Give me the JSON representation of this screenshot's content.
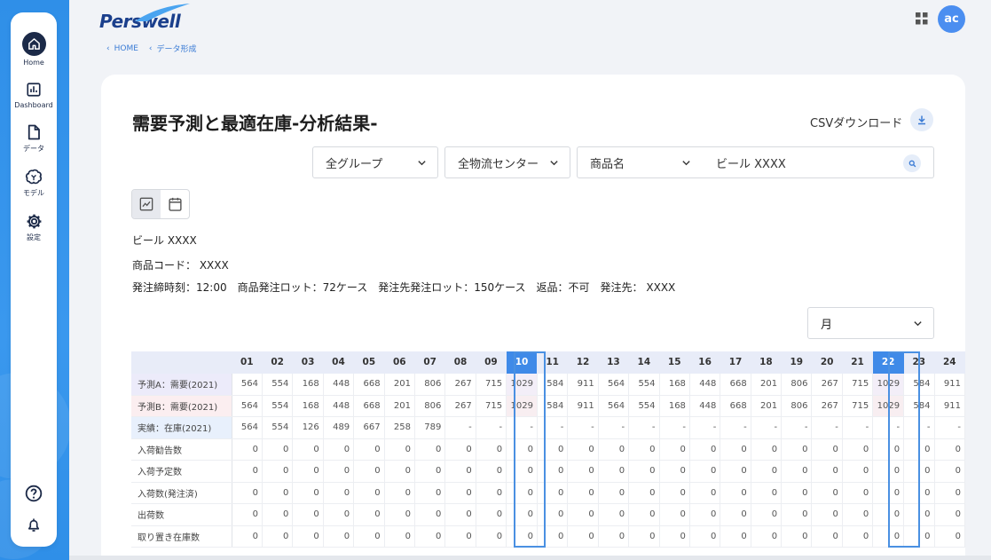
{
  "header": {
    "logo_text": "Perswell",
    "breadcrumb": [
      "HOME",
      "データ形成"
    ],
    "avatar_initials": "ac"
  },
  "sidebar": {
    "items": [
      {
        "label": "Home",
        "icon": "home-icon"
      },
      {
        "label": "Dashboard",
        "icon": "dashboard-icon"
      },
      {
        "label": "データ",
        "icon": "document-icon"
      },
      {
        "label": "モデル",
        "icon": "brain-icon"
      },
      {
        "label": "設定",
        "icon": "gear-icon"
      }
    ],
    "bottom_icons": [
      "help-icon",
      "bell-icon"
    ]
  },
  "main": {
    "title": "需要予測と最適在庫-分析結果-",
    "csv_label": "CSVダウンロード",
    "filters": {
      "group": "全グループ",
      "center": "全物流センター",
      "product_field": "商品名",
      "search_value": "ビール XXXX"
    },
    "product": {
      "name": "ビール XXXX",
      "code_line": "商品コード： XXXX",
      "detail_line": "発注締時刻：12:00　商品発注ロット：72ケース　発注先発注ロット：150ケース　返品：不可　発注先： XXXX"
    },
    "period_select": "月"
  },
  "table": {
    "columns": [
      "01",
      "02",
      "03",
      "04",
      "05",
      "06",
      "07",
      "08",
      "09",
      "10",
      "11",
      "12",
      "13",
      "14",
      "15",
      "16",
      "17",
      "18",
      "19",
      "20",
      "21",
      "22",
      "23",
      "24"
    ],
    "highlight_columns": [
      "10",
      "22"
    ],
    "rows": [
      {
        "label": "予測A：需要(2021)",
        "kind": "pa",
        "values": [
          "564",
          "554",
          "168",
          "448",
          "668",
          "201",
          "806",
          "267",
          "715",
          "1029",
          "584",
          "911",
          "564",
          "554",
          "168",
          "448",
          "668",
          "201",
          "806",
          "267",
          "715",
          "1029",
          "584",
          "911"
        ]
      },
      {
        "label": "予測B：需要(2021)",
        "kind": "pb",
        "values": [
          "564",
          "554",
          "168",
          "448",
          "668",
          "201",
          "806",
          "267",
          "715",
          "1029",
          "584",
          "911",
          "564",
          "554",
          "168",
          "448",
          "668",
          "201",
          "806",
          "267",
          "715",
          "1029",
          "584",
          "911"
        ]
      },
      {
        "label": "実績：在庫(2021)",
        "kind": "act",
        "values": [
          "564",
          "554",
          "126",
          "489",
          "667",
          "258",
          "789",
          "-",
          "-",
          "-",
          "-",
          "-",
          "-",
          "-",
          "-",
          "-",
          "-",
          "-",
          "-",
          "-",
          "-",
          "-",
          "-",
          "-"
        ]
      },
      {
        "label": "入荷勧告数",
        "kind": "z",
        "values": [
          "0",
          "0",
          "0",
          "0",
          "0",
          "0",
          "0",
          "0",
          "0",
          "0",
          "0",
          "0",
          "0",
          "0",
          "0",
          "0",
          "0",
          "0",
          "0",
          "0",
          "0",
          "0",
          "0",
          "0"
        ]
      },
      {
        "label": "入荷予定数",
        "kind": "z",
        "values": [
          "0",
          "0",
          "0",
          "0",
          "0",
          "0",
          "0",
          "0",
          "0",
          "0",
          "0",
          "0",
          "0",
          "0",
          "0",
          "0",
          "0",
          "0",
          "0",
          "0",
          "0",
          "0",
          "0",
          "0"
        ]
      },
      {
        "label": "入荷数(発注済)",
        "kind": "z",
        "values": [
          "0",
          "0",
          "0",
          "0",
          "0",
          "0",
          "0",
          "0",
          "0",
          "0",
          "0",
          "0",
          "0",
          "0",
          "0",
          "0",
          "0",
          "0",
          "0",
          "0",
          "0",
          "0",
          "0",
          "0"
        ]
      },
      {
        "label": "出荷数",
        "kind": "z",
        "values": [
          "0",
          "0",
          "0",
          "0",
          "0",
          "0",
          "0",
          "0",
          "0",
          "0",
          "0",
          "0",
          "0",
          "0",
          "0",
          "0",
          "0",
          "0",
          "0",
          "0",
          "0",
          "0",
          "0",
          "0"
        ]
      },
      {
        "label": "取り置き在庫数",
        "kind": "z",
        "values": [
          "0",
          "0",
          "0",
          "0",
          "0",
          "0",
          "0",
          "0",
          "0",
          "0",
          "0",
          "0",
          "0",
          "0",
          "0",
          "0",
          "0",
          "0",
          "0",
          "0",
          "0",
          "0",
          "0",
          "0"
        ]
      }
    ]
  },
  "colors": {
    "brand_blue": "#2f8fe8",
    "highlight_column": "#3f8ae8",
    "nav_dark": "#1c2a48"
  }
}
